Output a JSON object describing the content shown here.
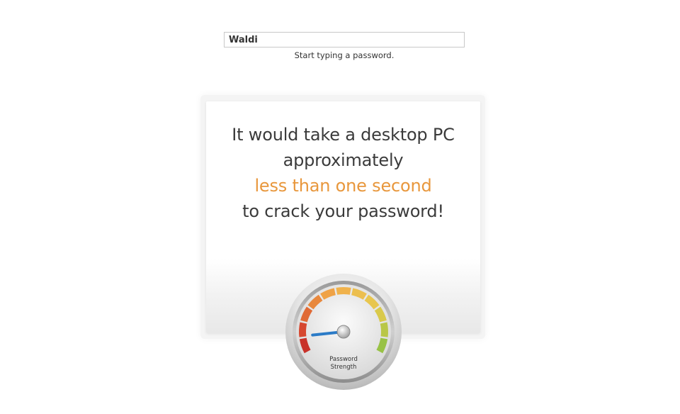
{
  "password_field": {
    "value": "Waldi",
    "hint": "Start typing a password."
  },
  "result": {
    "line1": "It would take a desktop PC",
    "line2": "approximately",
    "time": "less than one second",
    "line4": "to crack your password!"
  },
  "gauge": {
    "label_line1": "Password",
    "label_line2": "Strength",
    "strength_fraction": 0.1,
    "colors": {
      "segments": [
        "#c8322a",
        "#d6472f",
        "#e06a35",
        "#e8883d",
        "#efa246",
        "#f0b24c",
        "#ecbf4f",
        "#e8c64e",
        "#d9c94a",
        "#b9c748",
        "#98c245"
      ],
      "needle": "#2b7bc7",
      "time_text": "#e8973c"
    }
  }
}
